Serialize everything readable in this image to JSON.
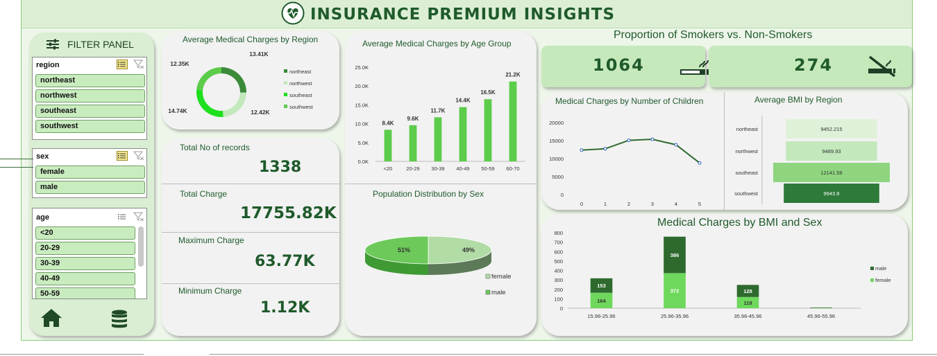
{
  "header": {
    "title": "INSURANCE PREMIUM INSIGHTS"
  },
  "filter_panel": {
    "title": "FILTER PANEL",
    "region": {
      "label": "region",
      "items": [
        "northeast",
        "northwest",
        "southeast",
        "southwest"
      ]
    },
    "sex": {
      "label": "sex",
      "items": [
        "female",
        "male"
      ]
    },
    "age": {
      "label": "age",
      "items": [
        "<20",
        "20-29",
        "30-39",
        "40-49",
        "50-59"
      ]
    },
    "icons": {
      "home": "home-icon",
      "database": "database-icon",
      "multi_select": "multi-select-icon",
      "clear_filter": "clear-filter-icon"
    }
  },
  "kpis": {
    "total_records": {
      "label": "Total No of records",
      "value": "1338"
    },
    "total_charge": {
      "label": "Total Charge",
      "value": "17755.82K"
    },
    "max_charge": {
      "label": "Maximum Charge",
      "value": "63.77K"
    },
    "min_charge": {
      "label": "Minimum Charge",
      "value": "1.12K"
    }
  },
  "smokers": {
    "title": "Proportion of Smokers vs. Non-Smokers",
    "smokers_value": "1064",
    "non_smokers_value": "274",
    "smoker_icon": "cigarette-icon",
    "non_smoker_icon": "no-smoking-icon"
  },
  "colors": {
    "dark_green": "#2e7a3a",
    "mid_green": "#5ccc4a",
    "light_green": "#bfe6b4",
    "bright_green": "#1ee01e",
    "title_green": "#1f5a2b"
  },
  "chart_data": [
    {
      "type": "pie",
      "title": "Average Medical Charges by Region",
      "categories": [
        "northeast",
        "northwest",
        "southeast",
        "southwest"
      ],
      "values": [
        13.41,
        12.42,
        14.74,
        12.35
      ],
      "labels": [
        "13.41K",
        "12.42K",
        "14.74K",
        "12.35K"
      ],
      "colors": [
        "#3a8a3a",
        "#c2e8bb",
        "#1ee01e",
        "#5ccc4a"
      ],
      "legend": "right"
    },
    {
      "type": "bar",
      "title": "Average Medical Charges by Age Group",
      "categories": [
        "<20",
        "20-29",
        "30-39",
        "40-49",
        "50-59",
        "60-70"
      ],
      "values": [
        8.4,
        9.6,
        11.7,
        14.4,
        16.5,
        21.2
      ],
      "labels": [
        "8.4K",
        "9.6K",
        "11.7K",
        "14.4K",
        "16.5K",
        "21.2K"
      ],
      "ylim": [
        0,
        25
      ],
      "yticks": [
        "0.0K",
        "5.0K",
        "10.0K",
        "15.0K",
        "20.0K",
        "25.0K"
      ]
    },
    {
      "type": "pie",
      "title": "Population Distribution by Sex",
      "categories": [
        "female",
        "male"
      ],
      "values": [
        49,
        51
      ],
      "labels": [
        "49%",
        "51%"
      ],
      "colors": [
        "#b2dca6",
        "#6cc95a"
      ],
      "legend": "right"
    },
    {
      "type": "line",
      "title": "Medical Charges by Number of Children",
      "x": [
        0,
        1,
        2,
        3,
        4,
        5
      ],
      "values": [
        12366,
        12731,
        15074,
        15355,
        13851,
        8786
      ],
      "ylim": [
        0,
        20000
      ],
      "yticks": [
        "0",
        "5000",
        "10000",
        "15000",
        "20000"
      ],
      "xticks": [
        "0",
        "1",
        "2",
        "3",
        "4",
        "5"
      ]
    },
    {
      "type": "bar",
      "title": "Average BMI by Region",
      "categories": [
        "northeast",
        "northwest",
        "southeast",
        "southwest"
      ],
      "values": [
        9452.215,
        9489.93,
        12141.58,
        9943.9
      ],
      "labels": [
        "9452.215",
        "9489.93",
        "12141.58",
        "9943.9"
      ],
      "colors": [
        "#dff2d9",
        "#c2e8bb",
        "#8fd57f",
        "#2e7a3a"
      ]
    },
    {
      "type": "bar",
      "title": "Medical Charges by BMI and Sex",
      "categories": [
        "15.96-25.96",
        "25.96-35.96",
        "35.96-45.96",
        "45.96-55.96"
      ],
      "series": [
        {
          "name": "female",
          "values": [
            164,
            372,
            119,
            3
          ]
        },
        {
          "name": "male",
          "values": [
            153,
            386,
            128,
            5
          ]
        }
      ],
      "labels": {
        "female": [
          "164",
          "372",
          "119",
          ""
        ],
        "male": [
          "153",
          "386",
          "128",
          ""
        ]
      },
      "ylim": [
        0,
        800
      ],
      "yticks": [
        "0",
        "100",
        "200",
        "300",
        "400",
        "500",
        "600",
        "700",
        "800"
      ],
      "legend": "right"
    }
  ]
}
